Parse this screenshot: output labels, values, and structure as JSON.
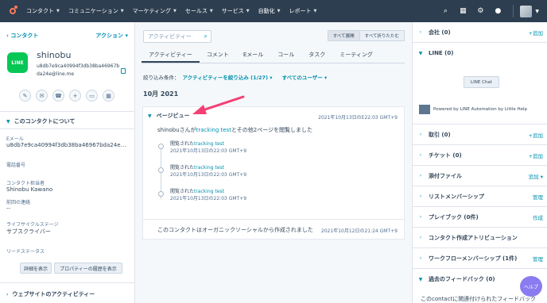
{
  "nav": {
    "items": [
      "コンタクト",
      "コミュニケーション",
      "マーケティング",
      "セールス",
      "サービス",
      "自動化",
      "レポート"
    ]
  },
  "contact": {
    "back_label": "コンタクト",
    "actions_label": "アクション",
    "avatar_text": "LINE",
    "name": "shinobu",
    "email": "u8db7e9ca40994f3db38ba46967bda24e@line.me",
    "about_title": "このコンタクトについて",
    "email_label": "Eメール",
    "email_value": "u8db7e9ca40994f3db38ba46967bda24e@line....",
    "phone_label": "電話番号",
    "owner_label": "コンタクト担当者",
    "owner_value": "Shinobu Kawano",
    "last_contact_label": "前回の連絡",
    "last_contact_value": "--",
    "lifecycle_label": "ライフサイクルステージ",
    "lifecycle_value": "サブスクライバー",
    "lead_status_label": "リードステータス",
    "details_button": "詳細を表示",
    "history_button": "プロパティーの履歴を表示",
    "website_activity_title": "ウェブサイトのアクティビティー"
  },
  "activity": {
    "search_placeholder": "アクティビティー",
    "expand_all": "すべて展開",
    "collapse_all": "すべて折りたたむ",
    "tabs": [
      "アクティビティー",
      "コメント",
      "Eメール",
      "コール",
      "タスク",
      "ミーティング"
    ],
    "filter_label": "絞り込み条件：",
    "filter_activity": "アクティビティーを絞り込み (1/27)",
    "filter_users": "すべてのユーザー",
    "month": "10月 2021",
    "pageview": {
      "title": "ページビュー",
      "date": "2021年10月13日のE22:03 GMT+9",
      "summary_prefix": "shinobuさんが",
      "summary_link": "tracking test",
      "summary_suffix": "とその他2ページを閲覧しました",
      "items": [
        {
          "prefix": "閲覧された",
          "link": "tracking test",
          "date": "2021年10月13日の22:03 GMT+9"
        },
        {
          "prefix": "閲覧された",
          "link": "tracking test",
          "date": "2021年10月13日の22:03 GMT+9"
        },
        {
          "prefix": "閲覧された",
          "link": "tracking test",
          "date": "2021年10月13日の22:03 GMT+9"
        }
      ]
    },
    "created": {
      "text": "このコンタクトはオーガニックソーシャルから作成されました",
      "date": "2021年10月12日の21:24 GMT+9"
    }
  },
  "right": {
    "company": "会社 (0)",
    "add": "+追加",
    "line": "LINE (0)",
    "line_chat": "LINE Chat",
    "powered": "Powered by LINE Automation by Little Help",
    "deals": "取引 (0)",
    "tickets": "チケット (0)",
    "attachments": "添付ファイル",
    "attach_add": "追加",
    "lists": "リストメンバーシップ",
    "manage": "管理",
    "playbooks": "プレイブック (0件)",
    "create": "作成",
    "attribution": "コンタクト作成アトリビューション",
    "workflows": "ワークフローメンバーシップ (1件)",
    "feedback": "過去のフィードバック (0)",
    "feedback_text": "このcontactに関連付けられたフィードバック",
    "help": "ヘルプ"
  }
}
